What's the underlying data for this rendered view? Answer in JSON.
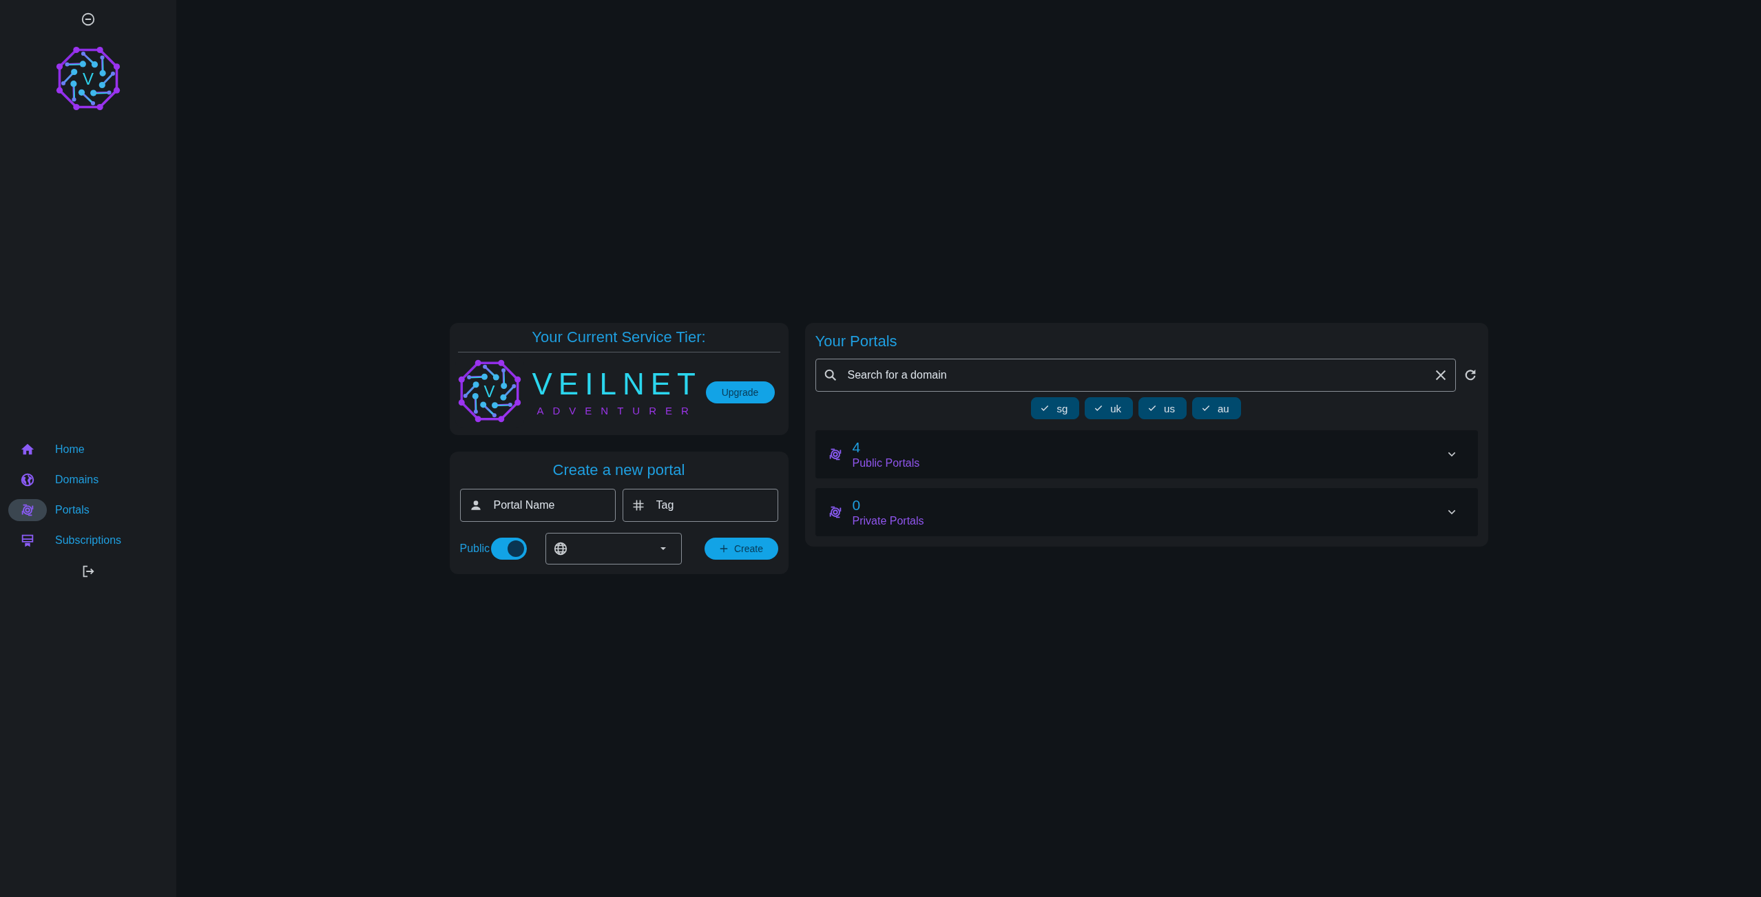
{
  "sidebar": {
    "logo_letter": "V",
    "nav_items": [
      {
        "label": "Home",
        "selected": false
      },
      {
        "label": "Domains",
        "selected": false
      },
      {
        "label": "Portals",
        "selected": true
      },
      {
        "label": "Subscriptions",
        "selected": false
      }
    ]
  },
  "tier_card": {
    "title": "Your Current Service Tier:",
    "logo_letter": "V",
    "brand": "VEILNET",
    "tier": "ADVENTURER",
    "upgrade_button": "Upgrade"
  },
  "create_portal": {
    "title": "Create a new portal",
    "name_field": {
      "placeholder": "Portal Name"
    },
    "tag_field": {
      "placeholder": "Tag"
    },
    "public_toggle": {
      "label": "Public",
      "on": true
    },
    "create_button": "Create"
  },
  "portals": {
    "title": "Your Portals",
    "search": {
      "placeholder": "Search for a domain"
    },
    "region_chips": [
      {
        "label": "sg",
        "selected": true
      },
      {
        "label": "uk",
        "selected": true
      },
      {
        "label": "us",
        "selected": true
      },
      {
        "label": "au",
        "selected": true
      }
    ],
    "groups": [
      {
        "count": "4",
        "label": "Public Portals",
        "expanded": false
      },
      {
        "count": "0",
        "label": "Private Portals",
        "expanded": false
      }
    ]
  }
}
